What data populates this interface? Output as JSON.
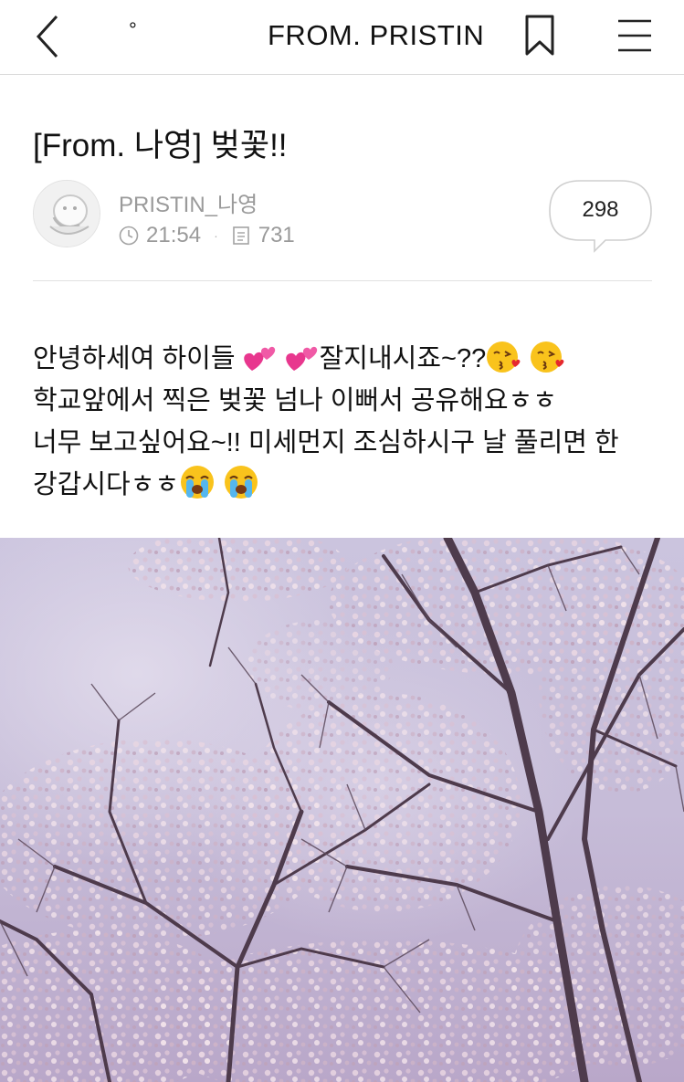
{
  "topbar": {
    "indicator": "°",
    "title": "FROM. PRISTIN"
  },
  "post": {
    "title": "[From. 나영] 벚꽃!!",
    "author": "PRISTIN_나영",
    "time": "21:54",
    "separator": "·",
    "views": "731",
    "comments": "298"
  },
  "body": {
    "line1_a": "안녕하세여 하이들 ",
    "line1_b": "잘지내시죠~??",
    "line2": "학교앞에서 찍은 벚꽃 넘나 이뻐서 공유해요ㅎㅎ",
    "line3": "너무 보고싶어요~!! 미세먼지 조심하시구 날 풀리면 한",
    "line4": "강갑시다ㅎㅎ"
  },
  "icons": {
    "back": "back-chevron-icon",
    "bookmark": "bookmark-icon",
    "menu": "hamburger-menu-icon",
    "clock": "clock-icon",
    "views": "document-icon",
    "heart": "two-hearts-emoji",
    "kiss": "face-blowing-kiss-emoji",
    "cry": "loudly-crying-face-emoji"
  },
  "colors": {
    "text": "#111111",
    "meta": "#9a9a9a",
    "divider": "#e1e1e1",
    "photo_sky": "#c9bfd9"
  }
}
